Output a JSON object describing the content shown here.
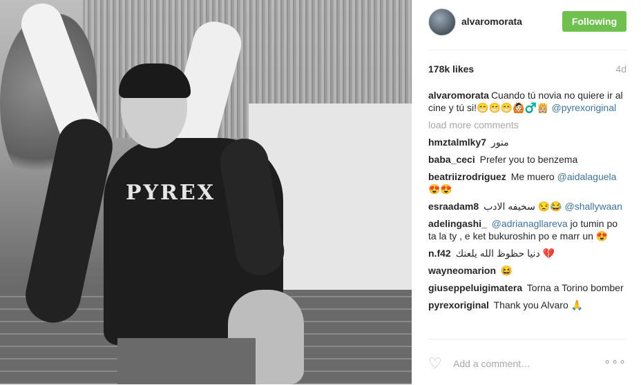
{
  "post": {
    "username": "alvaromorata",
    "follow_label": "Following",
    "likes": "178k likes",
    "time": "4d",
    "photo_text": "PYREX"
  },
  "caption": {
    "username": "alvaromorata",
    "text": "Cuando tú novia no quiere ir al cine y tú si!😁😁😁🙆🏻♂️👸🏼",
    "mention": "@pyrexoriginal"
  },
  "load_more": "load more comments",
  "comments": [
    {
      "user": "hmztalmlky7",
      "text": "منور",
      "mention": "",
      "after": ""
    },
    {
      "user": "baba_ceci",
      "text": "Prefer you to benzema",
      "mention": "",
      "after": ""
    },
    {
      "user": "beatriizrodriguez",
      "text": "Me muero",
      "mention": "@aidalaguela",
      "after": "😍😍"
    },
    {
      "user": "esraadam8",
      "text": "سخيفه الادب 😒😂",
      "mention": "@shallywaan",
      "after": ""
    },
    {
      "user": "adelingashi_",
      "text": "",
      "mention": "@adrianagllareva",
      "after": "jo tumin po ta la ty , e ket bukuroshin po e marr un 😍"
    },
    {
      "user": "n.f42",
      "text": "دنيا حظوظ الله يلعنك 💔",
      "mention": "",
      "after": ""
    },
    {
      "user": "wayneomarion",
      "text": "😆",
      "mention": "",
      "after": ""
    },
    {
      "user": "giuseppeluigimatera",
      "text": "Torna a Torino bomber",
      "mention": "",
      "after": ""
    },
    {
      "user": "pyrexoriginal",
      "text": "Thank you Alvaro 🙏",
      "mention": "",
      "after": ""
    }
  ],
  "footer": {
    "placeholder": "Add a comment…",
    "heart_icon": "heart-icon",
    "more_icon": "more-options-icon",
    "more_glyph": "∘∘∘"
  },
  "colors": {
    "follow_button": "#70c050",
    "mention": "#3f729b",
    "muted": "#a5a7aa"
  }
}
